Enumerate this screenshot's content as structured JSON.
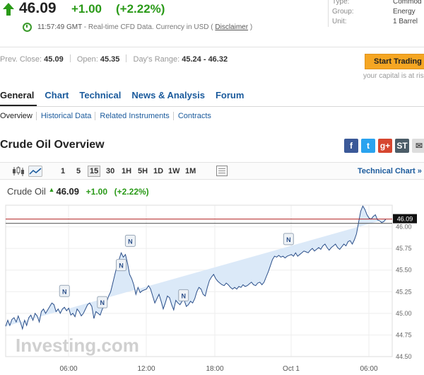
{
  "quote": {
    "price": "46.09",
    "change": "+1.00",
    "change_pct": "(+2.22%)",
    "time": "11:57:49 GMT",
    "time_note": "- Real-time CFD Data. Currency in USD (",
    "disclaimer": "Disclaimer",
    "time_close": ")"
  },
  "meta": {
    "type_label": "Type:",
    "type_value": "Commod",
    "group_label": "Group:",
    "group_value": "Energy",
    "unit_label": "Unit:",
    "unit_value": "1 Barrel"
  },
  "stats": {
    "prev_close_label": "Prev. Close:",
    "prev_close": "45.09",
    "open_label": "Open:",
    "open": "45.35",
    "range_label": "Day's Range:",
    "range": "45.24 - 46.32"
  },
  "cta": {
    "label": "Start Trading",
    "risk": "your capital is at ris"
  },
  "nav": {
    "tabs": [
      "General",
      "Chart",
      "Technical",
      "News & Analysis",
      "Forum"
    ],
    "subtabs": [
      "Overview",
      "Historical Data",
      "Related Instruments",
      "Contracts"
    ]
  },
  "section_title": "Crude Oil Overview",
  "share": {
    "facebook": "f",
    "twitter": "t",
    "google": "g+",
    "stocktwits": "ST"
  },
  "toolbar": {
    "timeframes": [
      "1",
      "5",
      "15",
      "30",
      "1H",
      "5H",
      "1D",
      "1W",
      "1M"
    ],
    "selected_timeframe": "15",
    "technical_chart": "Technical Chart »"
  },
  "chart_header": {
    "symbol": "Crude Oil",
    "price": "46.09",
    "change": "+1.00",
    "change_pct": "(+2.22%)"
  },
  "watermark": "Investing.com",
  "colors": {
    "green": "#2a9a18",
    "link": "#1a5a9c",
    "cta": "#f5a623",
    "area_fill": "#dbe9f8",
    "line": "#2b4f8a",
    "ref_red": "#b22222"
  },
  "chart_data": {
    "type": "area",
    "ylim": [
      44.5,
      46.25
    ],
    "yticks": [
      "46.00",
      "45.75",
      "45.50",
      "45.25",
      "45.00",
      "44.75",
      "44.50"
    ],
    "xticks": [
      "06:00",
      "12:00",
      "18:00",
      "Oct 1",
      "06:00"
    ],
    "last_label": "46.09",
    "prev_close": 45.09,
    "reference_lines": [
      46.09,
      46.04
    ],
    "x": [
      0,
      3,
      6,
      9,
      12,
      15,
      18,
      21,
      24,
      27,
      30,
      33,
      36,
      39,
      42,
      45,
      48,
      51,
      54,
      57,
      60,
      63,
      66,
      69,
      72,
      75,
      78,
      81,
      84,
      87,
      90,
      93,
      96,
      99,
      102,
      105,
      108,
      111,
      114,
      117,
      120,
      123,
      126,
      129,
      132,
      135,
      138,
      141,
      144,
      147,
      150,
      153,
      156,
      159,
      162,
      165,
      168,
      171,
      174,
      177,
      180,
      183,
      186,
      189,
      192,
      195,
      198,
      201,
      204,
      207,
      210,
      213,
      216,
      219,
      222,
      225,
      228,
      231,
      234,
      237,
      240,
      243,
      246,
      249,
      252,
      255,
      258,
      261,
      264,
      267,
      270,
      273,
      276,
      279,
      282,
      285,
      288,
      291,
      294,
      297,
      300,
      303,
      306,
      309,
      312,
      315,
      318,
      321,
      324,
      327,
      330,
      333,
      336,
      339,
      342,
      345,
      348,
      351,
      354,
      357,
      360,
      363,
      366,
      369,
      372,
      375,
      378,
      381,
      384,
      387,
      390,
      393,
      396,
      399,
      402,
      405,
      408,
      411,
      414,
      417,
      420,
      423,
      426,
      429,
      432,
      435,
      438,
      441,
      444,
      447,
      450,
      453,
      456,
      459,
      462,
      465,
      468,
      471,
      474,
      477,
      480,
      483,
      486,
      489,
      492,
      495,
      498,
      501,
      504,
      507,
      510,
      513,
      516,
      519,
      522,
      525,
      528,
      531,
      534,
      537,
      540,
      543,
      546,
      549,
      552
    ],
    "values": [
      44.85,
      44.92,
      44.86,
      44.93,
      44.95,
      44.9,
      44.97,
      44.9,
      44.82,
      44.92,
      44.86,
      44.95,
      44.98,
      44.92,
      45.0,
      44.97,
      44.9,
      45.02,
      45.05,
      45.0,
      45.04,
      45.08,
      45.12,
      45.1,
      45.02,
      45.05,
      45.0,
      45.05,
      45.07,
      45.03,
      45.06,
      44.98,
      45.0,
      44.96,
      45.05,
      45.02,
      44.97,
      45.0,
      45.05,
      45.1,
      45.12,
      45.08,
      44.94,
      45.02,
      45.0,
      44.98,
      45.05,
      45.08,
      45.12,
      45.2,
      45.25,
      45.35,
      45.45,
      45.55,
      45.62,
      45.7,
      45.65,
      45.68,
      45.58,
      45.45,
      45.4,
      45.33,
      45.22,
      45.3,
      45.24,
      45.26,
      45.27,
      45.28,
      45.32,
      45.28,
      45.2,
      45.12,
      45.17,
      45.22,
      45.14,
      45.05,
      45.12,
      45.2,
      45.18,
      45.1,
      45.04,
      45.15,
      45.12,
      45.1,
      45.14,
      45.15,
      45.08,
      45.1,
      45.14,
      45.12,
      45.17,
      45.25,
      45.3,
      45.28,
      45.22,
      45.2,
      45.3,
      45.38,
      45.42,
      45.45,
      45.4,
      45.37,
      45.35,
      45.33,
      45.32,
      45.35,
      45.33,
      45.3,
      45.28,
      45.3,
      45.28,
      45.31,
      45.3,
      45.33,
      45.31,
      45.32,
      45.34,
      45.36,
      45.33,
      45.32,
      45.35,
      45.36,
      45.33,
      45.36,
      45.42,
      45.48,
      45.55,
      45.62,
      45.66,
      45.65,
      45.67,
      45.65,
      45.66,
      45.64,
      45.66,
      45.67,
      45.68,
      45.66,
      45.7,
      45.66,
      45.68,
      45.7,
      45.72,
      45.71,
      45.7,
      45.73,
      45.75,
      45.72,
      45.74,
      45.76,
      45.74,
      45.78,
      45.8,
      45.76,
      45.73,
      45.76,
      45.78,
      45.8,
      45.76,
      45.74,
      45.77,
      45.8,
      45.78,
      45.83,
      45.84,
      45.8,
      45.85,
      45.92,
      46.05,
      46.18,
      46.24,
      46.2,
      46.14,
      46.1,
      46.09,
      46.12,
      46.14,
      46.08,
      46.07,
      46.05,
      46.06,
      46.09
    ],
    "markers": [
      {
        "label": "N",
        "x": 84,
        "value": 45.25
      },
      {
        "label": "N",
        "x": 138,
        "value": 45.12
      },
      {
        "label": "N",
        "x": 165,
        "value": 45.55
      },
      {
        "label": "N",
        "x": 178,
        "value": 45.83
      },
      {
        "label": "N",
        "x": 254,
        "value": 45.2
      },
      {
        "label": "N",
        "x": 404,
        "value": 45.85
      }
    ]
  }
}
